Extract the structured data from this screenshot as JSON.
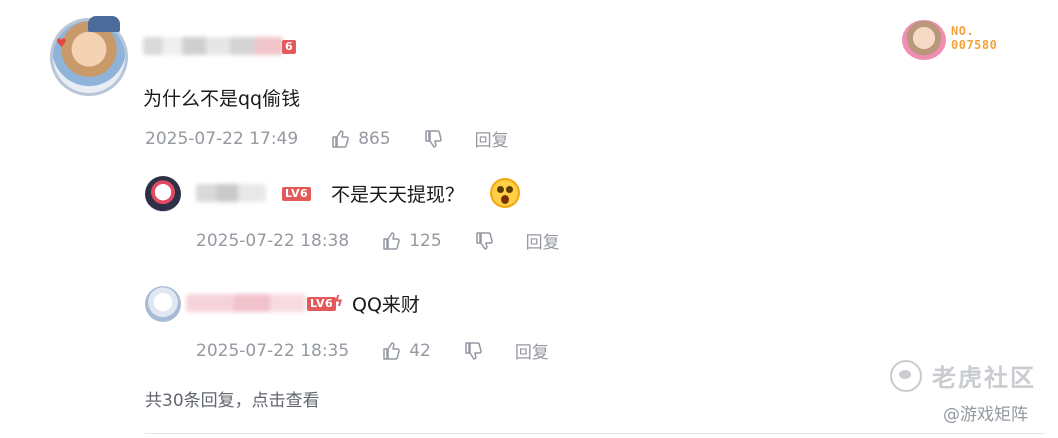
{
  "main_comment": {
    "level_badge": "6",
    "fan_medal_label": "NO.",
    "fan_medal_number": "007580",
    "content": "为什么不是qq偷钱",
    "time": "2025-07-22 17:49",
    "likes": "865",
    "reply_label": "回复"
  },
  "replies": [
    {
      "level_badge": "LV6",
      "content": "不是天天提现？",
      "emoji": "shock-emoji",
      "time": "2025-07-22 18:38",
      "likes": "125",
      "reply_label": "回复"
    },
    {
      "level_badge": "LV6",
      "content": "QQ来财",
      "time": "2025-07-22 18:35",
      "likes": "42",
      "reply_label": "回复"
    }
  ],
  "more_replies": "共30条回复，点击查看",
  "watermark": {
    "site": "老虎社区",
    "handle": "@游戏矩阵"
  },
  "colors": {
    "text_primary": "#18191c",
    "text_meta": "#9499a0",
    "level_badge": "#e35a5a",
    "fan_medal": "#f4a33a"
  }
}
